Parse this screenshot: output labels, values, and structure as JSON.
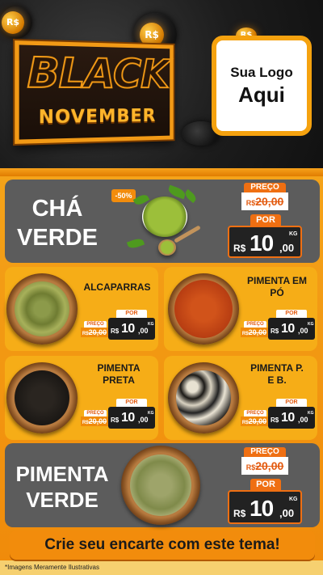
{
  "header": {
    "brand_top": "BLACK",
    "brand_bottom": "NOVEMBER",
    "coin_symbol": "R$",
    "logo_line1": "Sua Logo",
    "logo_line2": "Aqui"
  },
  "colors": {
    "accent": "#f28c0c",
    "card_dark": "#5c5c5c",
    "card_yellow": "#f6ad17",
    "price_dark": "#222222"
  },
  "featured": [
    {
      "name_line1": "CHÁ",
      "name_line2": "VERDE",
      "discount": "-50%",
      "label_old": "PREÇO",
      "old_currency": "R$",
      "old_price": "20,00",
      "label_new": "POR",
      "currency": "R$",
      "price_int": "10",
      "price_dec": ",00",
      "unit": "KG"
    },
    {
      "name_line1": "PIMENTA",
      "name_line2": "VERDE",
      "label_old": "PREÇO",
      "old_currency": "R$",
      "old_price": "20,00",
      "label_new": "POR",
      "currency": "R$",
      "price_int": "10",
      "price_dec": ",00",
      "unit": "KG"
    }
  ],
  "products": [
    {
      "name_line1": "ALCAPARRAS",
      "name_line2": "",
      "label_old": "PREÇO",
      "old_currency": "R$",
      "old_price": "20,00",
      "label_new": "POR",
      "currency": "R$",
      "price_int": "10",
      "price_dec": ",00",
      "unit": "KG"
    },
    {
      "name_line1": "PIMENTA EM",
      "name_line2": "PÓ",
      "label_old": "PREÇO",
      "old_currency": "R$",
      "old_price": "20,00",
      "label_new": "POR",
      "currency": "R$",
      "price_int": "10",
      "price_dec": ",00",
      "unit": "KG"
    },
    {
      "name_line1": "PIMENTA",
      "name_line2": "PRETA",
      "label_old": "PREÇO",
      "old_currency": "R$",
      "old_price": "20,00",
      "label_new": "POR",
      "currency": "R$",
      "price_int": "10",
      "price_dec": ",00",
      "unit": "KG"
    },
    {
      "name_line1": "PIMENTA P.",
      "name_line2": "E B.",
      "label_old": "PREÇO",
      "old_currency": "R$",
      "old_price": "20,00",
      "label_new": "POR",
      "currency": "R$",
      "price_int": "10",
      "price_dec": ",00",
      "unit": "KG"
    }
  ],
  "cta": {
    "label": "Crie seu encarte com este tema!"
  },
  "footnote": "*Imagens Meramente Ilustrativas"
}
